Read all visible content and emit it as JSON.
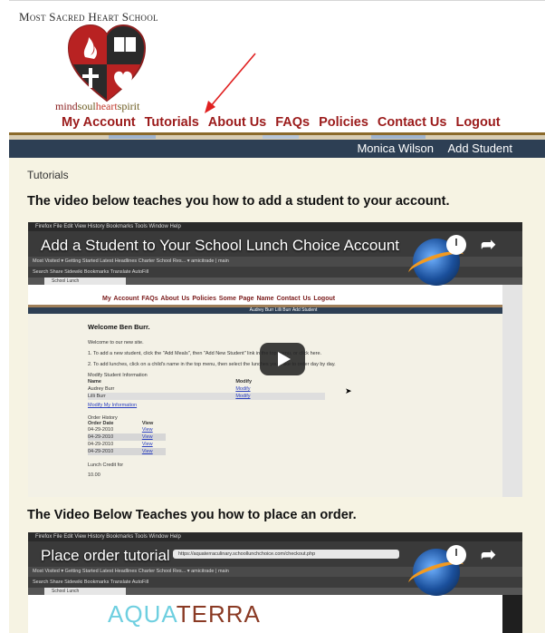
{
  "header": {
    "school_name": "Most Sacred Heart School",
    "tagline": {
      "mind": "mind",
      "soul": "soul",
      "heart": "heart",
      "spirit": "spirit"
    },
    "nav": [
      "My Account",
      "Tutorials",
      "About Us",
      "FAQs",
      "Policies",
      "Contact Us",
      "Logout"
    ]
  },
  "userbar": {
    "user_name": "Monica Wilson",
    "add_student": "Add Student"
  },
  "content": {
    "breadcrumb": "Tutorials",
    "heading1": "The video below teaches you how to add a student to your account.",
    "heading2": "The Video Below Teaches you how to place an order."
  },
  "video1": {
    "title": "Add a Student to Your School Lunch Choice Account",
    "mac_menu": "Firefox  File  Edit  View  History  Bookmarks  Tools  Window  Help",
    "bookmarks_bar": "Most Visited ▾   Getting Started   Latest Headlines   Charter School Res... ▾   amicitrade | main",
    "toolbar": "Search   Share   Sidewiki   Bookmarks   Translate   AutoFill",
    "tab_label": "School Lunch",
    "inner_nav": "My Account  FAQs  About Us  Policies  Some Page Name  Contact Us  Logout",
    "inner_userbar": "Audrey Burr   Lilli Burr   Add Student",
    "welcome": "Welcome Ben Burr.",
    "welcome_text": "Welcome to our new site.",
    "step1": "1. To add a new student, click the \"Add Meals\", then \"Add New Student\" link in the top menu, or click here.",
    "step2": "2. To add lunches, click on a child's name in the top menu, then select the lunches you'd like to order day by day.",
    "modify_heading": "Modify Student Information",
    "students_header": [
      "Name",
      "Modify"
    ],
    "students": [
      {
        "name": "Audrey Burr",
        "action": "Modify"
      },
      {
        "name": "Lilli Burr",
        "action": "Modify"
      }
    ],
    "modify_info_link": "Modify My Information",
    "order_history_heading": "Order History",
    "orders_header": [
      "Order Date",
      "View"
    ],
    "orders": [
      {
        "date": "04-29-2010",
        "action": "View"
      },
      {
        "date": "04-29-2010",
        "action": "View"
      },
      {
        "date": "04-29-2010",
        "action": "View"
      },
      {
        "date": "04-29-2010",
        "action": "View"
      }
    ],
    "lunch_credit_label": "Lunch Credit for",
    "lunch_credit_value": "10.00"
  },
  "video2": {
    "title": "Place order tutorial",
    "mac_menu": "Firefox  File  Edit  View  History  Bookmarks  Tools  Window  Help",
    "url": "https://aquaterraculinary.schoollunchchoice.com/checkout.php",
    "bookmarks_bar": "Most Visited ▾   Getting Started   Latest Headlines   Charter School Res... ▾   amicitrade | main",
    "toolbar": "Search   Share   Sidewiki   Bookmarks   Translate   AutoFill",
    "tab_label": "School Lunch",
    "logo_aqua": "AQUA",
    "logo_terra": "TERRA"
  },
  "colors": {
    "nav_text": "#9b1b1b",
    "userbar_bg": "#2d3f54",
    "content_bg": "#f6f3e3",
    "annotation_arrow": "#e02020"
  },
  "icons": [
    "logo-crest",
    "play-icon",
    "watch-later-icon",
    "share-icon",
    "annotation-arrow"
  ]
}
